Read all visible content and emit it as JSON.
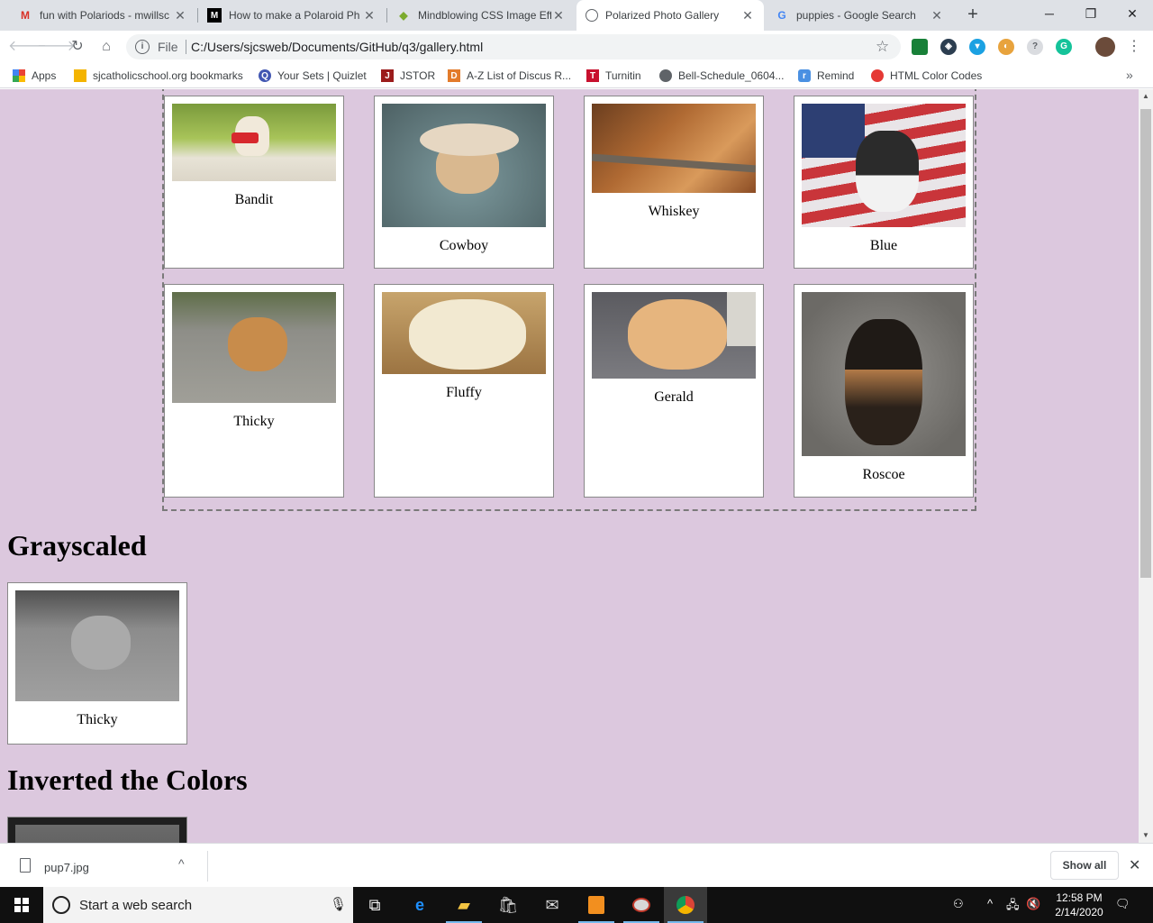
{
  "browser": {
    "tabs": [
      {
        "title": "fun with Polariods - mwillsc",
        "favicon": "gmail-icon",
        "active": false
      },
      {
        "title": "How to make a Polaroid Ph",
        "favicon": "medium-icon",
        "active": false
      },
      {
        "title": "Mindblowing CSS Image Eff",
        "favicon": "codepen-diamond-icon",
        "active": false
      },
      {
        "title": "Polarized Photo Gallery",
        "favicon": "globe-icon",
        "active": true
      },
      {
        "title": "puppies - Google Search",
        "favicon": "google-icon",
        "active": false
      }
    ],
    "new_tab": "+",
    "window_controls": {
      "minimize": "─",
      "maximize": "❐",
      "close": "✕"
    },
    "address": {
      "scheme_label": "File",
      "url": "C:/Users/sjcsweb/Documents/GitHub/q3/gallery.html"
    },
    "bookmarks": [
      {
        "label": "Apps",
        "icon": "apps-grid-icon"
      },
      {
        "label": "sjcatholicschool.org bookmarks",
        "icon": "folder-icon"
      },
      {
        "label": "Your Sets | Quizlet",
        "icon": "quizlet-icon"
      },
      {
        "label": "JSTOR",
        "icon": "jstor-icon"
      },
      {
        "label": "A-Z List of Discus R...",
        "icon": "discus-icon"
      },
      {
        "label": "Turnitin",
        "icon": "turnitin-icon"
      },
      {
        "label": "Bell-Schedule_0604...",
        "icon": "globe-icon"
      },
      {
        "label": "Remind",
        "icon": "remind-icon"
      },
      {
        "label": "HTML Color Codes",
        "icon": "html-color-codes-icon"
      }
    ],
    "bookmarks_more": "»"
  },
  "gallery": {
    "cards": [
      {
        "name": "Bandit",
        "photo": "white puppy with red bandana on grass",
        "colors": [
          "#9fbf52",
          "#e9e2d0"
        ]
      },
      {
        "name": "Cowboy",
        "photo": "golden puppy in cowboy hat",
        "colors": [
          "#6e8a8e",
          "#d6b995"
        ]
      },
      {
        "name": "Whiskey",
        "photo": "red puppy chewing stick",
        "colors": [
          "#9b5a2e",
          "#d89255"
        ]
      },
      {
        "name": "Blue",
        "photo": "husky puppy with flag",
        "colors": [
          "#c7c2c8",
          "#2a2a2a"
        ]
      },
      {
        "name": "Thicky",
        "photo": "golden puppy on road",
        "colors": [
          "#8d8d87",
          "#c68a4a"
        ]
      },
      {
        "name": "Fluffy",
        "photo": "fluffy cream puppy",
        "colors": [
          "#b08a52",
          "#f1e7cc"
        ]
      },
      {
        "name": "Gerald",
        "photo": "golden puppy with remote",
        "colors": [
          "#6f6f73",
          "#e3b27c"
        ]
      },
      {
        "name": "Roscoe",
        "photo": "german shepherd puppy",
        "colors": [
          "#7e7c78",
          "#2b2118"
        ]
      }
    ]
  },
  "sections": {
    "grayscaled": {
      "heading": "Grayscaled",
      "caption": "Thicky"
    },
    "inverted": {
      "heading": "Inverted the Colors"
    }
  },
  "download_shelf": {
    "file_name": "pup7.jpg",
    "show_all": "Show all",
    "close": "✕"
  },
  "taskbar": {
    "search_placeholder": "Start a web search",
    "apps": [
      "task-view-icon",
      "edge-icon",
      "file-explorer-icon",
      "store-icon",
      "mail-icon",
      "sublime-text-icon",
      "paint-icon",
      "chrome-icon"
    ],
    "time": "12:58 PM",
    "date": "2/14/2020"
  }
}
